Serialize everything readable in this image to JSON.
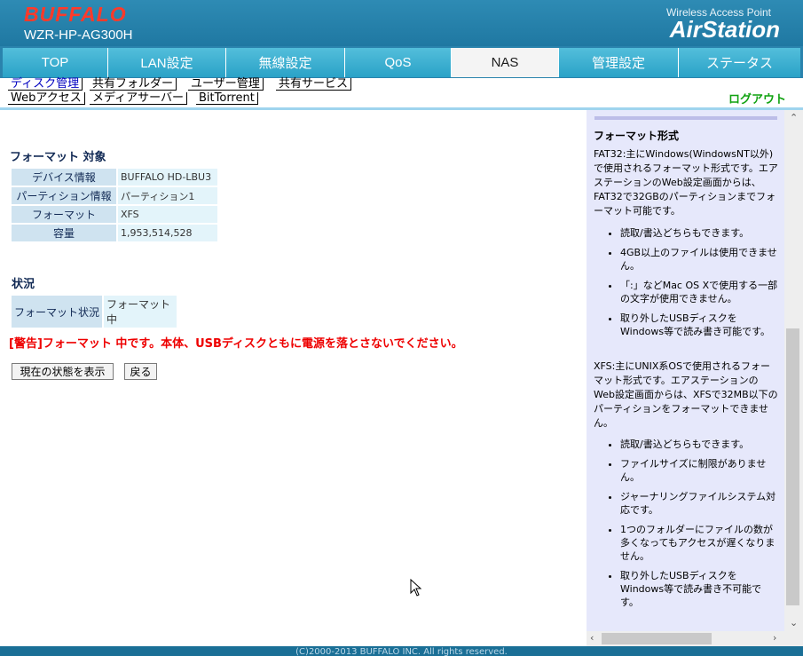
{
  "header": {
    "brand": "BUFFALO",
    "model": "WZR-HP-AG300H",
    "product_line": "Wireless Access Point",
    "product_name": "AirStation"
  },
  "nav": {
    "tabs": [
      {
        "label": "TOP"
      },
      {
        "label": "LAN設定"
      },
      {
        "label": "無線設定"
      },
      {
        "label": "QoS"
      },
      {
        "label": "NAS"
      },
      {
        "label": "管理設定"
      },
      {
        "label": "ステータス"
      }
    ],
    "active": "NAS"
  },
  "subnav": {
    "row1": [
      "ディスク管理",
      "共有フォルダー",
      "ユーザー管理",
      "共有サービス"
    ],
    "row2": [
      "Webアクセス",
      "メディアサーバー",
      "BitTorrent"
    ],
    "logout": "ログアウト"
  },
  "format_target": {
    "title": "フォーマット 対象",
    "rows": [
      {
        "label": "デバイス情報",
        "value": "BUFFALO HD-LBU3"
      },
      {
        "label": "パーティション情報",
        "value": "パーティション1"
      },
      {
        "label": "フォーマット",
        "value": "XFS"
      },
      {
        "label": "容量",
        "value": "1,953,514,528"
      }
    ]
  },
  "status": {
    "title": "状況",
    "label": "フォーマット状況",
    "value": "フォーマット中"
  },
  "warning": "[警告]フォーマット 中です。本体、USBディスクともに電源を落とさないでください。",
  "buttons": {
    "refresh": "現在の状態を表示",
    "back": "戻る"
  },
  "help": {
    "title": "フォーマット形式",
    "fat32_text": "FAT32:主にWindows(WindowsNT以外)で使用されるフォーマット形式です。エアステーションのWeb設定画面からは、FAT32で32GBのパーティションまでフォーマット可能です。",
    "fat32_items": [
      "読取/書込どちらもできます。",
      "4GB以上のファイルは使用できません。",
      "「:」などMac OS Xで使用する一部の文字が使用できません。",
      "取り外したUSBディスクをWindows等で読み書き可能です。"
    ],
    "xfs_text": "XFS:主にUNIX系OSで使用されるフォーマット形式です。エアステーションのWeb設定画面からは、XFSで32MB以下のパーティションをフォーマットできません。",
    "xfs_items": [
      "読取/書込どちらもできます。",
      "ファイルサイズに制限がありません。",
      "ジャーナリングファイルシステム対応です。",
      "1つのフォルダーにファイルの数が多くなってもアクセスが遅くなりません。",
      "取り外したUSBディスクをWindows等で読み書き不可能です。"
    ]
  },
  "footer": "(C)2000-2013 BUFFALO INC. All rights reserved."
}
